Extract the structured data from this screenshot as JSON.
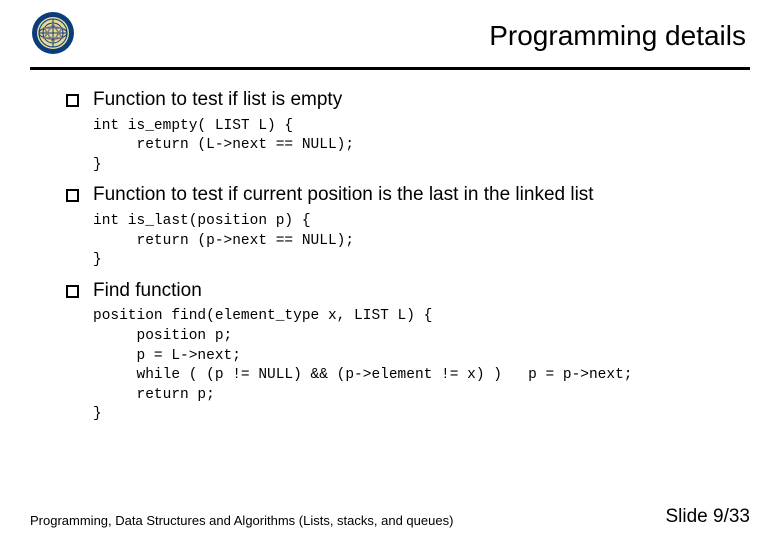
{
  "title": "Programming details",
  "bullets": [
    {
      "text": "Function to test if list is empty",
      "code": "int is_empty( LIST L) {\n     return (L->next == NULL);\n}"
    },
    {
      "text": "Function to test if current position is the last in the linked list",
      "code": "int is_last(position p) {\n     return (p->next == NULL);\n}"
    },
    {
      "text": "Find function",
      "code": "position find(element_type x, LIST L) {\n     position p;\n     p = L->next;\n     while ( (p != NULL) && (p->element != x) )   p = p->next;\n     return p;\n}"
    }
  ],
  "footer": {
    "left": "Programming, Data Structures and Algorithms  (Lists, stacks, and queues)",
    "right": "Slide 9/33"
  }
}
